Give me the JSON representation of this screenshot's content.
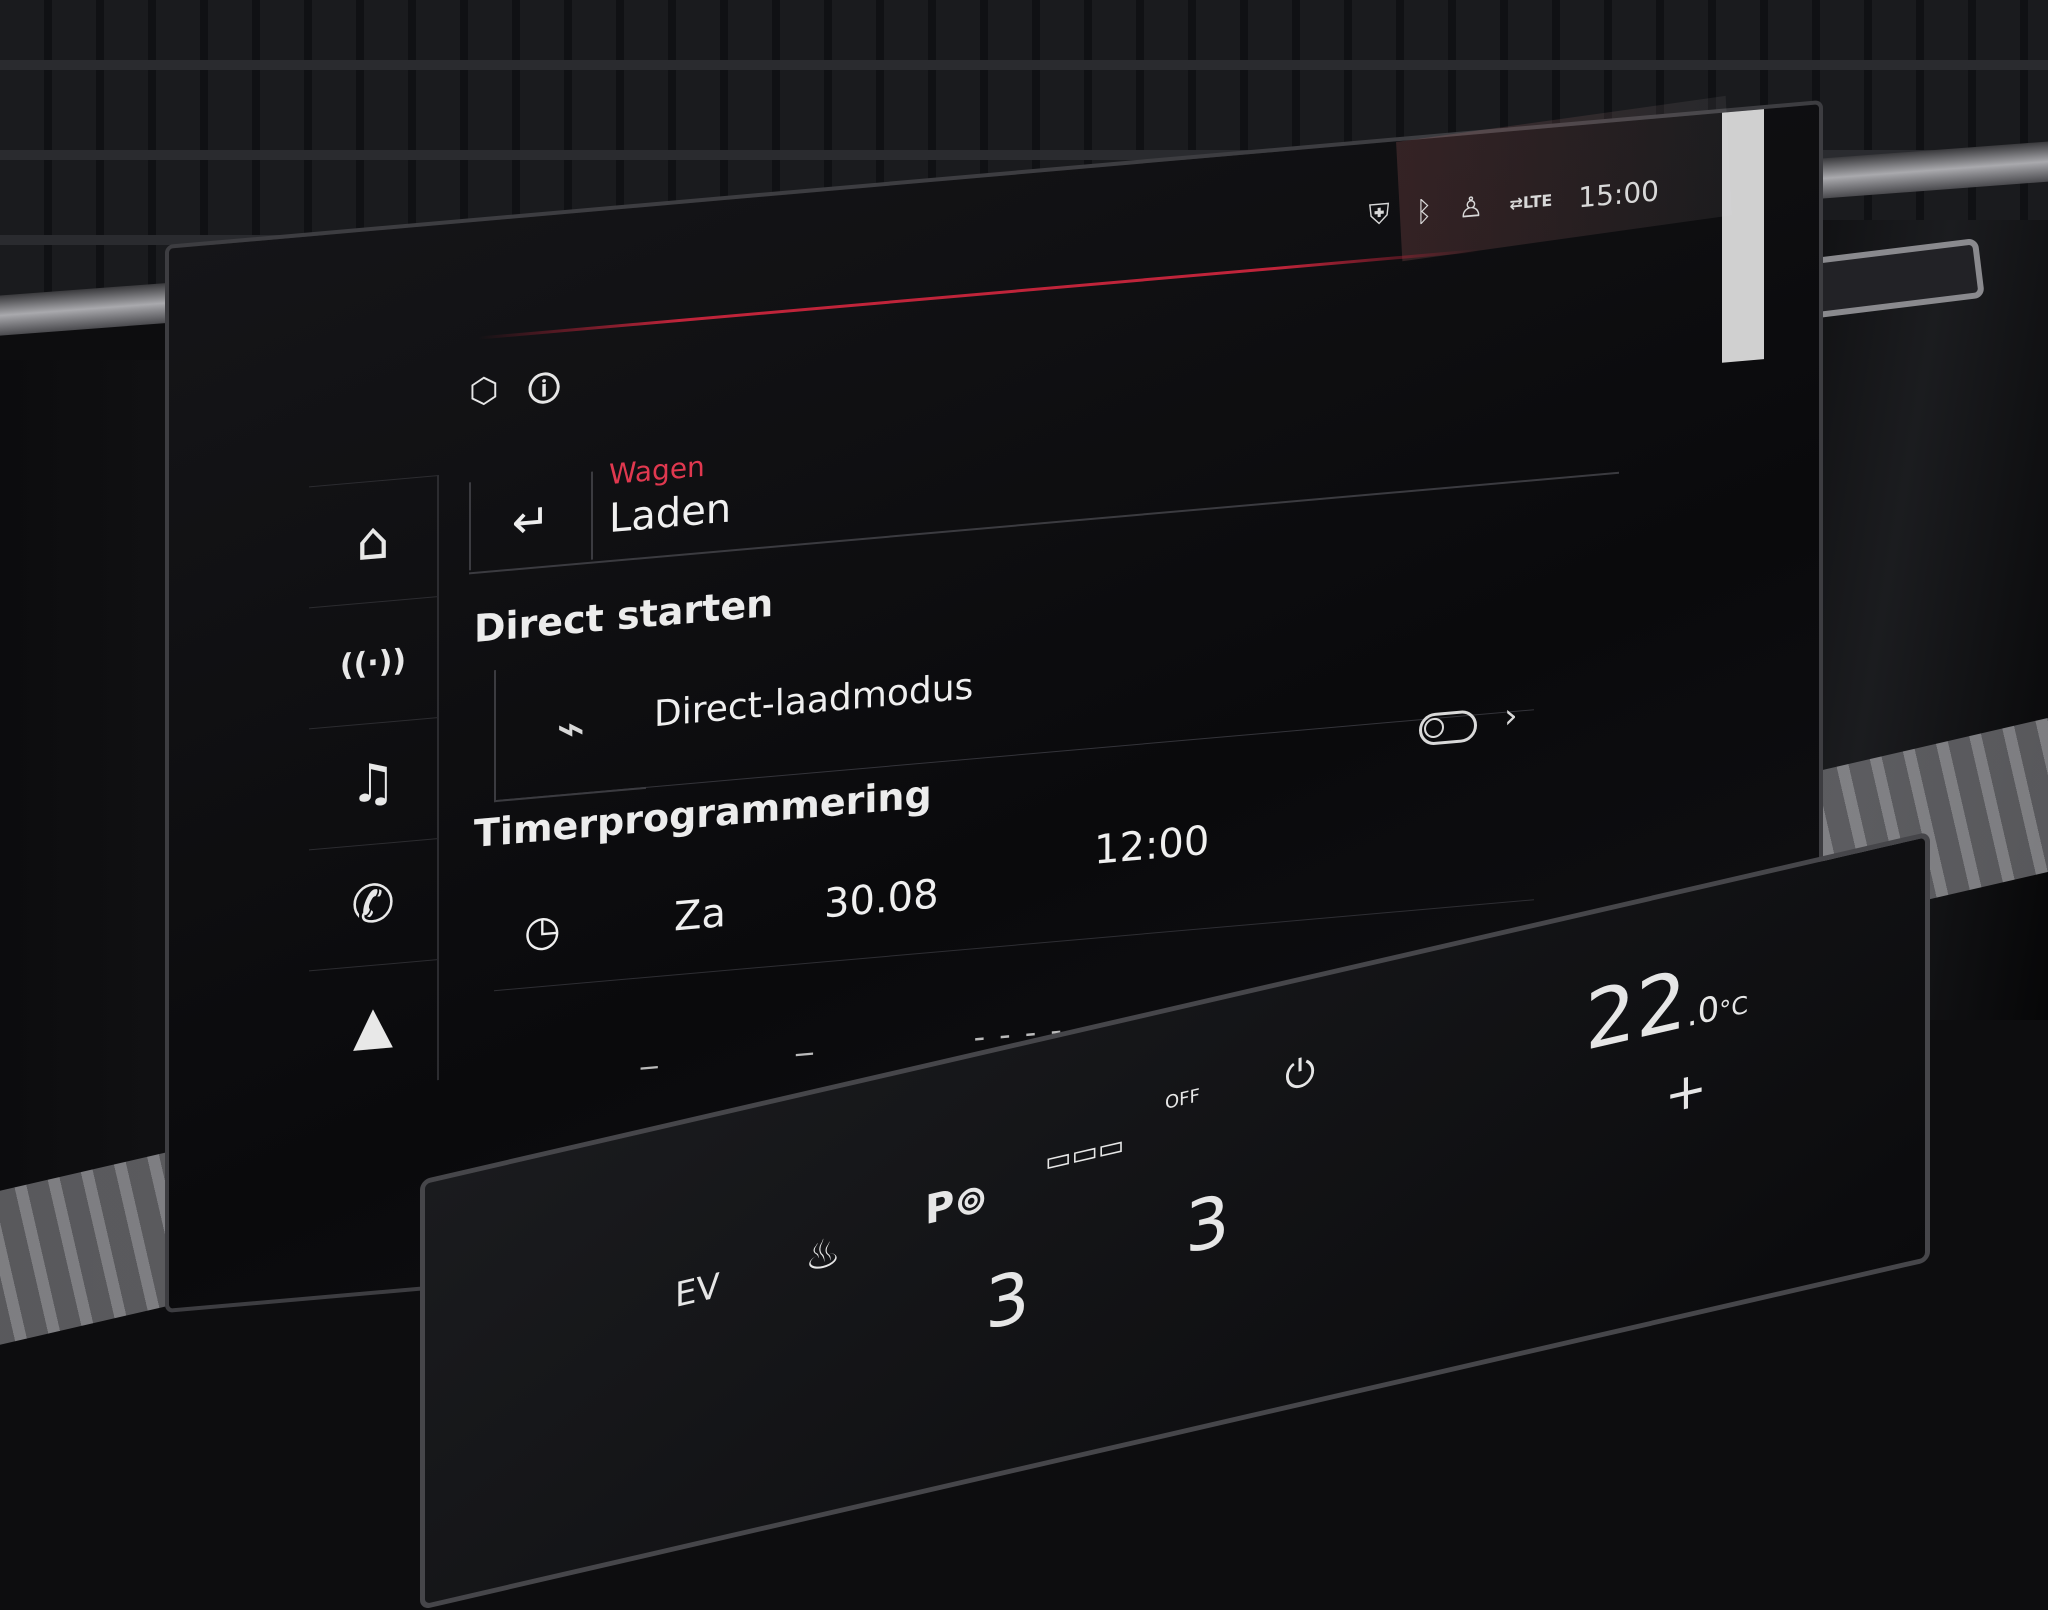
{
  "status_bar": {
    "time": "15:00",
    "icons": [
      "location-shield-icon",
      "bluetooth-icon",
      "seat-person-icon",
      "lte-signal-icon"
    ],
    "lte_label": "LTE"
  },
  "top_icons": [
    "cube-icon",
    "car-info-icon"
  ],
  "sidebar": {
    "items": [
      {
        "name": "home-icon",
        "glyph": "⌂"
      },
      {
        "name": "radio-icon",
        "glyph": "((·))"
      },
      {
        "name": "media-icon",
        "glyph": "♫"
      },
      {
        "name": "phone-icon",
        "glyph": "✆"
      },
      {
        "name": "navigation-icon",
        "glyph": "▲"
      }
    ]
  },
  "header": {
    "breadcrumb": "Wagen",
    "title": "Laden",
    "back_glyph": "↵"
  },
  "sections": {
    "direct_start": "Direct starten",
    "timer": "Timerprogrammering"
  },
  "direct_mode": {
    "label": "Direct-laadmodus",
    "plug_glyph": "⌁"
  },
  "timer": {
    "day": "Za",
    "date": "30.08",
    "time": "12:00",
    "clock_glyph": "◷",
    "toggle_on": false
  },
  "climate": {
    "temperature": "22",
    "temperature_decimal": ".0",
    "unit": "°C",
    "fan_left": "3",
    "fan_right": "3",
    "ev_label": "EV",
    "defrost_off_label": "OFF",
    "plus_label": "+"
  },
  "colors": {
    "accent_red": "#e0384f",
    "text": "#efefef",
    "screen_bg": "#0a0a0c"
  }
}
